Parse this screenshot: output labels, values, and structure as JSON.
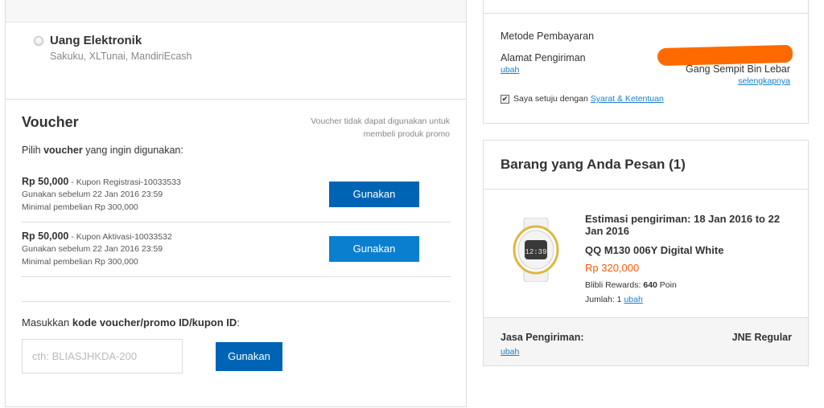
{
  "payment": {
    "ewallet_title": "Uang Elektronik",
    "ewallet_subtitle": "Sakuku, XLTunai, MandiriEcash"
  },
  "voucher": {
    "title": "Voucher",
    "note": "Voucher tidak dapat digunakan untuk membeli produk promo",
    "prompt_pre": "Pilih ",
    "prompt_bold": "voucher",
    "prompt_post": " yang ingin digunakan:",
    "items": [
      {
        "amount": "Rp 50,000",
        "code": " - Kupon Registrasi-10033533",
        "expiry": "Gunakan sebelum 22 Jan 2016 23:59",
        "minimum": "Minimal pembelian Rp 300,000",
        "button": "Gunakan"
      },
      {
        "amount": "Rp 50,000",
        "code": " - Kupon Aktivasi-10033532",
        "expiry": "Gunakan sebelum 22 Jan 2016 23:59",
        "minimum": "Minimal pembelian Rp 300,000",
        "button": "Gunakan"
      }
    ],
    "promo_label_pre": "Masukkan ",
    "promo_label_bold": "kode voucher/promo ID/kupon ID",
    "promo_label_post": ":",
    "promo_placeholder": "cth: BLIASJHKDA-200",
    "promo_button": "Gunakan"
  },
  "summary": {
    "method_label": "Metode Pembayaran",
    "address_label": "Alamat Pengiriman",
    "address_change": "ubah",
    "address_value": "Gang Sempit Bin Lebar",
    "address_more": "selengkapnya",
    "agree_text": "Saya setuju dengan ",
    "agree_link": "Syarat & Ketentuan",
    "agree_checked": true
  },
  "order": {
    "title": "Barang yang Anda Pesan (1)",
    "estimate": "Estimasi pengiriman: 18 Jan 2016 to 22 Jan 2016",
    "product_name": "QQ M130 006Y Digital White",
    "price": "Rp 320,000",
    "rewards_label": "Blibli Rewards: ",
    "rewards_points": "640",
    "rewards_unit": " Poin",
    "qty_label": "Jumlah: 1",
    "qty_change": "ubah",
    "shipping_label": "Jasa Pengiriman:",
    "shipping_value": "JNE Regular",
    "shipping_change": "ubah",
    "watch_display": "12:39"
  },
  "colors": {
    "button_primary": "#0064b4",
    "button_secondary": "#0a7fd0",
    "link": "#1a7fc9",
    "price": "#ff5a00",
    "redaction": "#ff6a00"
  }
}
